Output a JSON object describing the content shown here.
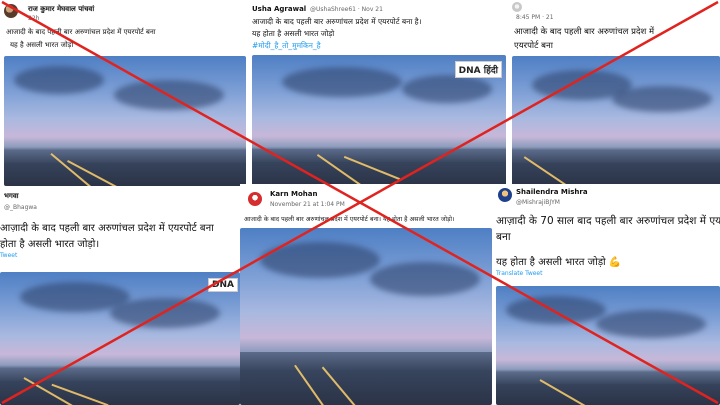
{
  "post1": {
    "name": "राज कुमार मेघवाल पांचवां",
    "time": "22h",
    "line1": "आजादी के बाद पहली बार अरुणांचल प्रदेश में एयरपोर्ट बना",
    "line2": "यह है असली भारत जोड़ो"
  },
  "post2": {
    "name": "Usha Agrawal",
    "handle": "@UshaShree61 · Nov 21",
    "line1": "आजादी के बाद पहली बार अरुणांचल प्रदेश में एयरपोर्ट बना है।",
    "line2": "यह होता है असली भारत जोड़ो",
    "hashtag": "#मोदी_है_तो_मुमकिन_है",
    "watermark": "DNA हिंदी"
  },
  "post3": {
    "time": "8:45 PM · 21",
    "line1": "आजादी के बाद पहली बार अरुणांचल प्रदेश में",
    "line2": "एयरपोर्ट बना"
  },
  "post4": {
    "name": "भगवा",
    "handle": "@_Bhagwa",
    "line1": "आज़ादी के बाद पहली बार अरुणांचल प्रदेश में एयरपोर्ट बना",
    "line2": "होता है असली भारत जोड़ो।",
    "translate": "Tweet",
    "watermark": "DNA"
  },
  "post5": {
    "name": "Karn Mohan",
    "time": "November 21 at 1:04 PM",
    "line1": "आजादी के बाद पहली बार अरुणांचल प्रदेश में एयरपोर्ट बना। यह होता है असली भारत जोड़ो।"
  },
  "post6": {
    "name": "Shailendra Mishra",
    "handle": "@MishrajiBJYM",
    "line1": "आज़ादी के 70 साल बाद पहली बार अरुणांचल प्रदेश में एयरपोर्ट",
    "line2": "बना",
    "line3": "यह होता है असली भारत जोड़ो 💪",
    "translate": "Translate Tweet"
  },
  "colors": {
    "cross": "#e0231f",
    "link": "#1d9bf0",
    "runway_light": "#f4c96a"
  }
}
